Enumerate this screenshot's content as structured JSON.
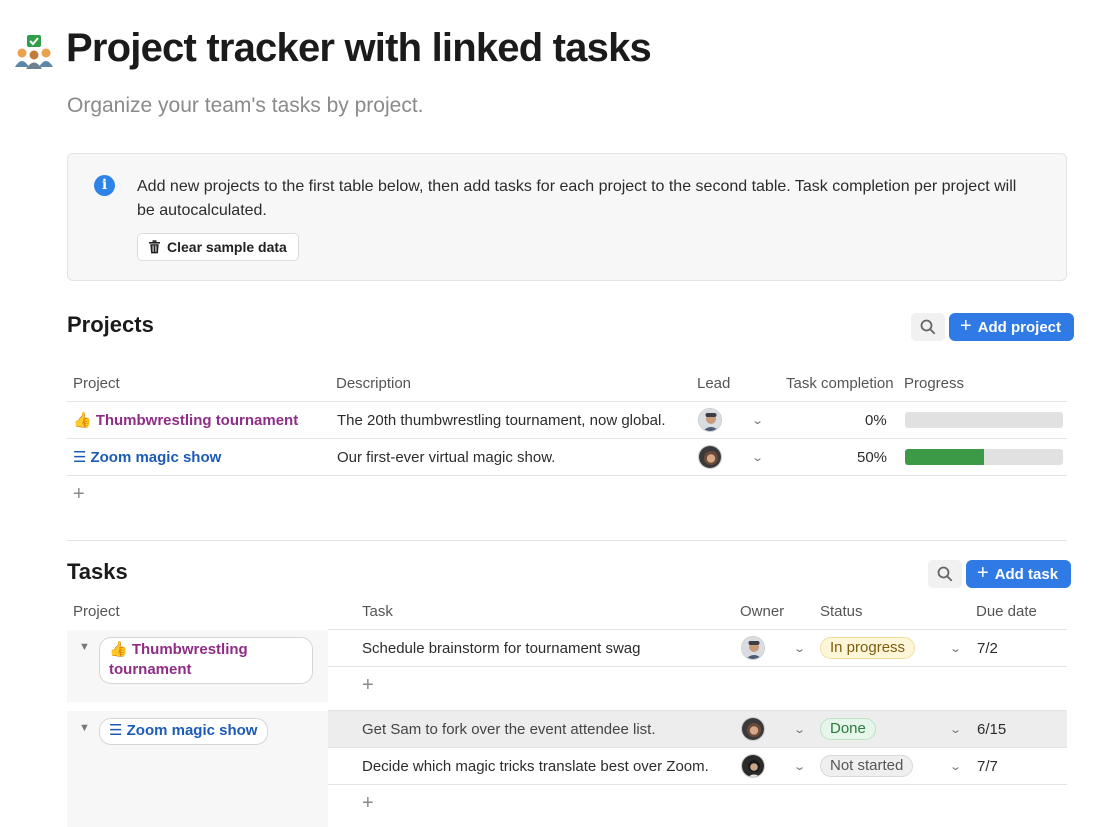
{
  "page": {
    "title": "Project tracker with linked tasks",
    "subtitle": "Organize your team's tasks by project."
  },
  "callout": {
    "text": "Add new projects to the first table below, then add tasks for each project to the second table. Task completion per project will be autocalculated.",
    "clear_button": "Clear sample data",
    "icon": "info-icon"
  },
  "projects": {
    "title": "Projects",
    "add_button": "Add project",
    "columns": [
      "Project",
      "Description",
      "Lead",
      "Task completion",
      "Progress"
    ],
    "rows": [
      {
        "emoji": "👍",
        "name": "Thumbwrestling tournament",
        "description": "The 20th thumbwrestling tournament, now global.",
        "completion": "0%",
        "progress": 0
      },
      {
        "emoji": "☰",
        "name": "Zoom magic show",
        "description": "Our first-ever virtual magic show.",
        "completion": "50%",
        "progress": 0.5
      }
    ]
  },
  "tasks": {
    "title": "Tasks",
    "add_button": "Add task",
    "columns": [
      "Project",
      "Task",
      "Owner",
      "Status",
      "Due date"
    ],
    "groups": [
      {
        "emoji": "👍",
        "project": "Thumbwrestling tournament",
        "project_line1": "Thumbwrestling",
        "project_line2": "tournament",
        "rows": [
          {
            "task": "Schedule brainstorm for tournament swag",
            "status": "In progress",
            "due": "7/2"
          }
        ]
      },
      {
        "emoji": "☰",
        "project": "Zoom magic show",
        "rows": [
          {
            "task": "Get Sam to fork over the event attendee list.",
            "status": "Done",
            "due": "6/15"
          },
          {
            "task": "Decide which magic tricks translate best over Zoom.",
            "status": "Not started",
            "due": "7/7"
          }
        ]
      }
    ]
  },
  "colors": {
    "accent": "#2f7ae5",
    "project_purple": "#8f2d86",
    "project_blue": "#1c5bb7",
    "progress_green": "#3c9a47"
  }
}
